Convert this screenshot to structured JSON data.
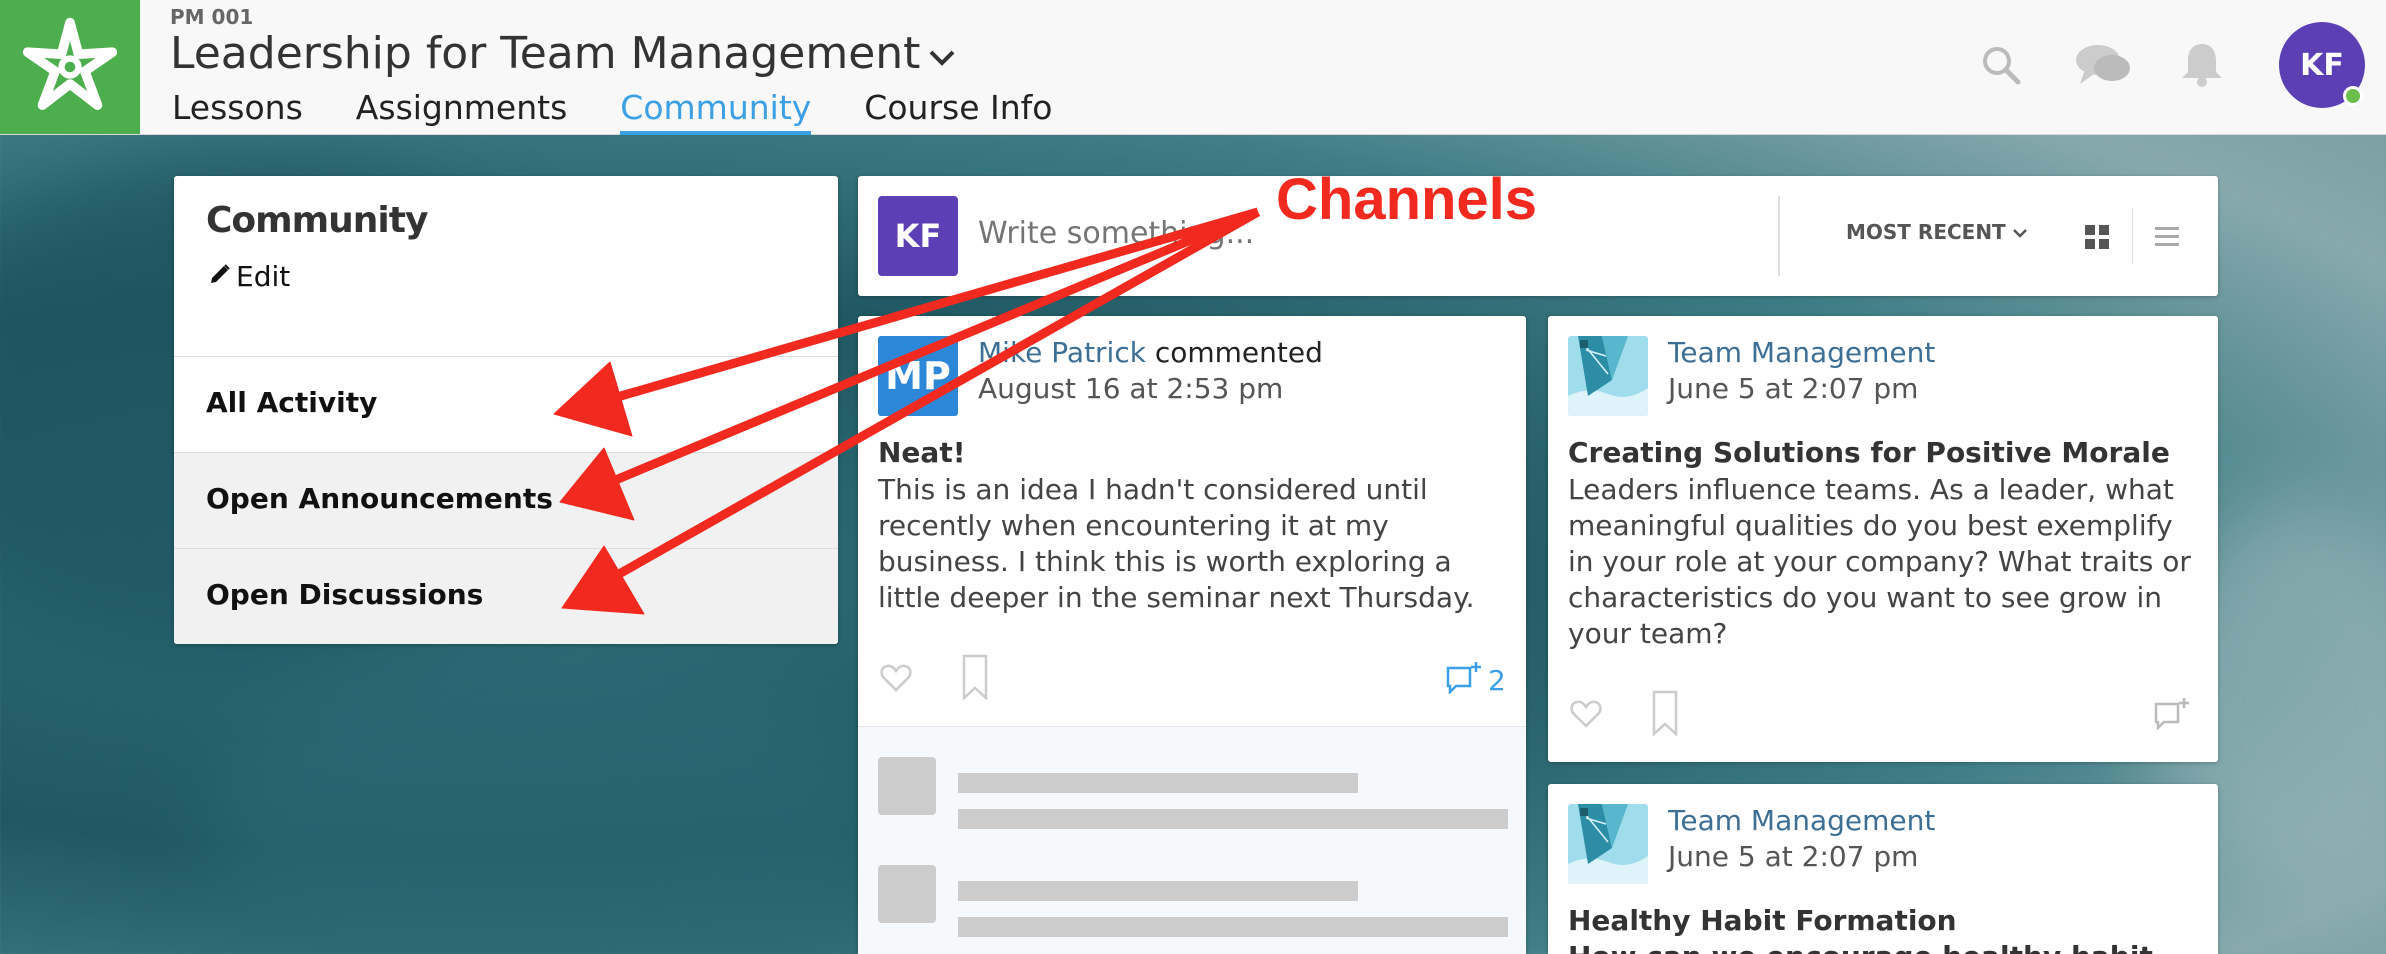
{
  "header": {
    "course_code": "PM 001",
    "course_title": "Leadership for Team Management",
    "tabs": [
      {
        "label": "Lessons"
      },
      {
        "label": "Assignments"
      },
      {
        "label": "Community"
      },
      {
        "label": "Course Info"
      }
    ],
    "active_tab": "Community",
    "user_initials": "KF",
    "icons": [
      "logo-icon",
      "search-icon",
      "chat-icon",
      "bell-icon"
    ]
  },
  "sidebar": {
    "title": "Community",
    "edit_label": "Edit",
    "items": [
      {
        "label": "All Activity"
      },
      {
        "label": "Open Announcements"
      },
      {
        "label": "Open Discussions"
      }
    ]
  },
  "composer": {
    "avatar_initials": "KF",
    "placeholder": "Write something...",
    "sort_label": "MOST RECENT"
  },
  "posts": [
    {
      "avatar_initials": "MP",
      "author": "Mike Patrick",
      "verb": "commented",
      "date": "August 16 at 2:53 pm",
      "title": "Neat!",
      "body": "This is an idea I hadn't considered until recently when encountering it at my business. I think this is worth exploring a little deeper in the seminar next Thursday.",
      "comment_count": "2"
    },
    {
      "author": "Team Management",
      "date": "June 5 at 2:07 pm",
      "title": "Creating Solutions for Positive Morale",
      "body": "Leaders influence teams. As a leader, what meaningful qualities do you best exemplify in your role at your company? What traits or characteristics do you want to see grow in your team?"
    },
    {
      "author": "Team Management",
      "date": "June 5 at 2:07 pm",
      "title": "Healthy Habit Formation",
      "body": "How can we encourage healthy habit"
    }
  ],
  "annotation": {
    "label": "Channels",
    "color": "#f2291f"
  },
  "colors": {
    "accent": "#3ba0e6",
    "logo_green": "#4cae4c",
    "avatar_purple": "#5d3fb5"
  }
}
